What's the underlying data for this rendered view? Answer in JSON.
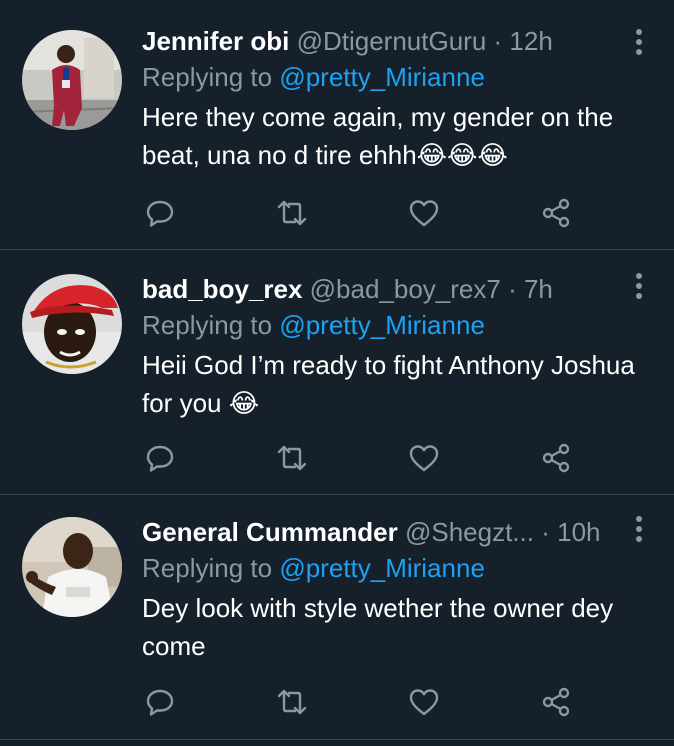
{
  "tweets": [
    {
      "name": "Jennifer obi",
      "handle": "@DtigernutGuru",
      "sep": " · ",
      "time": "12h",
      "replying_prefix": "Replying to ",
      "replying_to": "@pretty_Mirianne",
      "text": "Here they come again, my gender on the beat, una no d tire ehhh😂😂😂",
      "avatar_icon": "woman-in-red-photo"
    },
    {
      "name": "bad_boy_rex",
      "handle": "@bad_boy_rex7",
      "sep": " · ",
      "time": "7h",
      "replying_prefix": "Replying to ",
      "replying_to": "@pretty_Mirianne",
      "text": "Heii God I’m ready to fight Anthony Joshua for you 😂",
      "avatar_icon": "man-in-red-cap-photo"
    },
    {
      "name": "General Cummander",
      "handle": "@Shegzt...",
      "sep": " · ",
      "time": "10h",
      "replying_prefix": "Replying to ",
      "replying_to": "@pretty_Mirianne",
      "text": "Dey look with style wether the owner dey come",
      "avatar_icon": "man-in-white-shirt-photo"
    }
  ],
  "icons": {
    "reply": "comment-bubble-icon",
    "retweet": "retweet-icon",
    "like": "heart-icon",
    "share": "share-icon",
    "more": "vertical-ellipsis-icon"
  },
  "colors": {
    "background": "#15202b",
    "divider": "#38444d",
    "secondary_text": "#8899a6",
    "mention": "#1da1f2",
    "icon": "#8899a6"
  }
}
